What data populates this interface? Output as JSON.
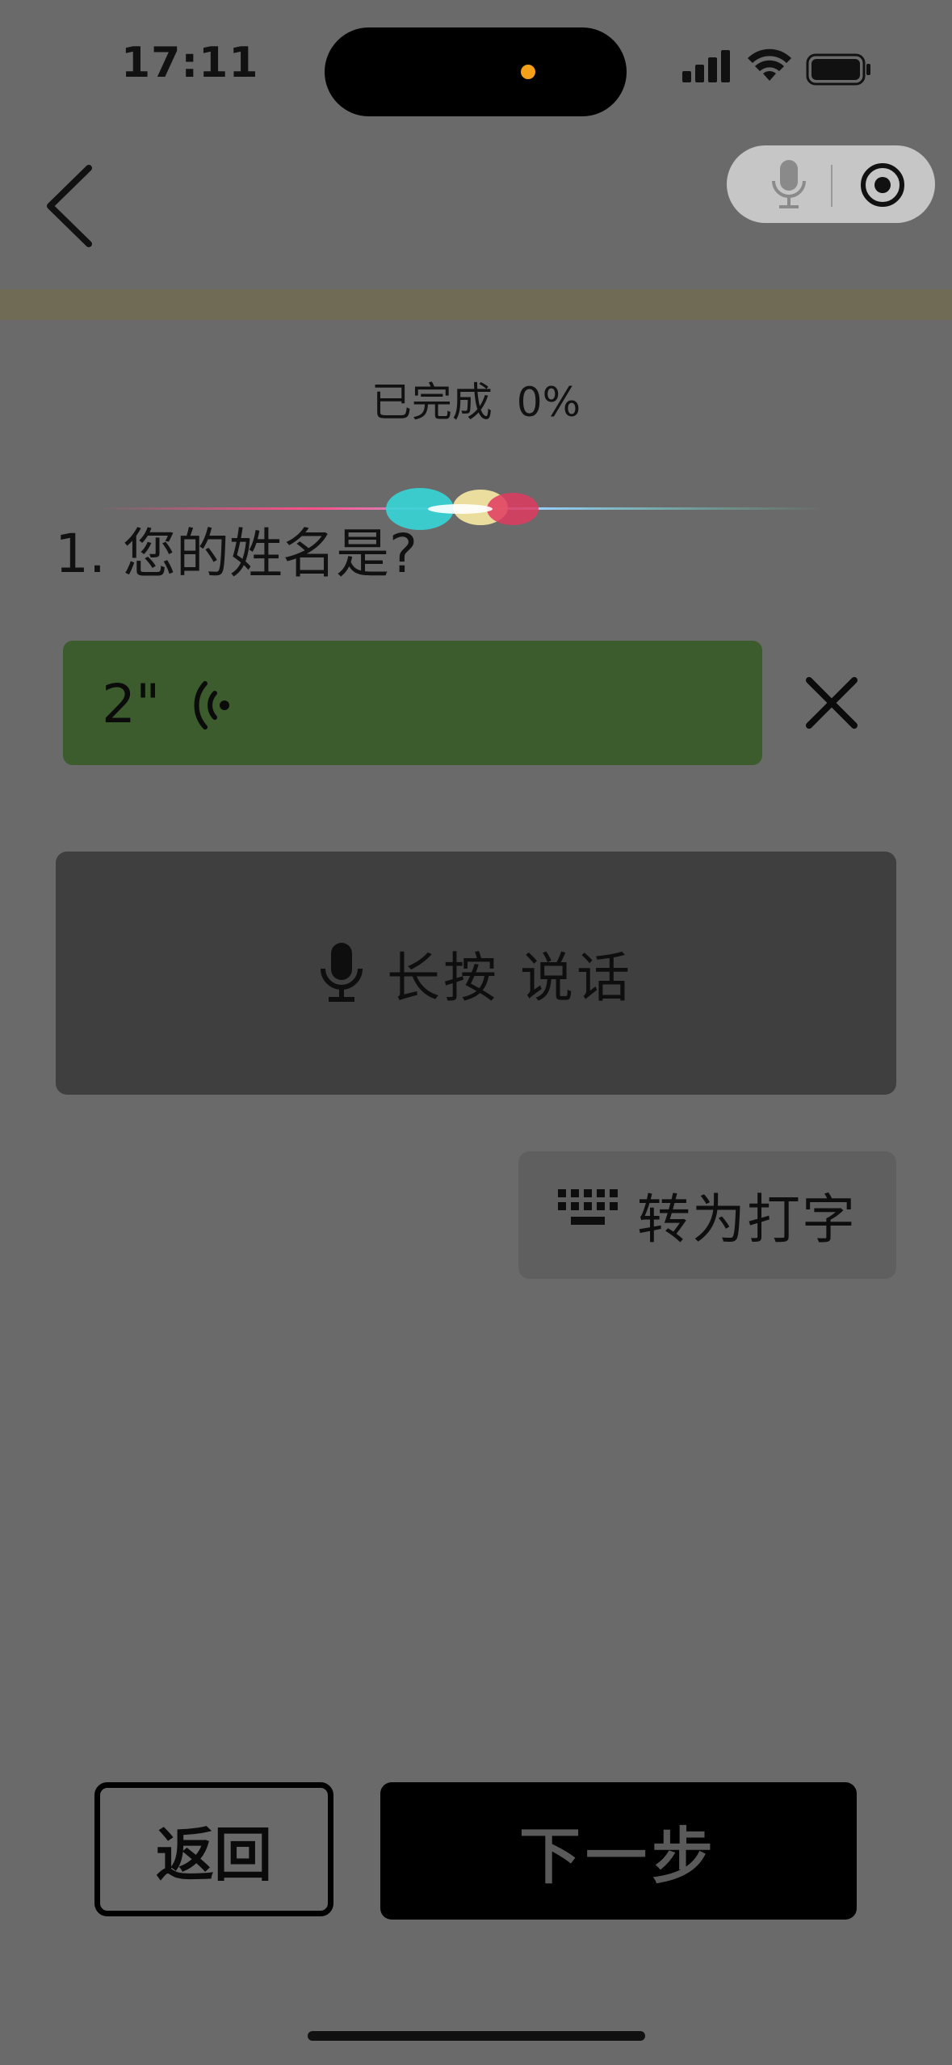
{
  "status_bar": {
    "time": "17:11"
  },
  "progress": {
    "label": "已完成",
    "value": "0%"
  },
  "question": {
    "text": "1. 您的姓名是?"
  },
  "voice_message": {
    "duration": "2\""
  },
  "hold_to_talk": {
    "label": "长按 说话"
  },
  "switch_typing": {
    "label": "转为打字"
  },
  "footer": {
    "back_label": "返回",
    "next_label": "下一步"
  },
  "colors": {
    "background": "#6a6a6a",
    "voice_bubble": "#3d5c2d",
    "hold_button": "#3f3f3f",
    "recording_dot": "#f4a019"
  },
  "icons": [
    "back-chevron-icon",
    "microphone-icon",
    "target-icon",
    "close-icon",
    "keyboard-icon",
    "sound-wave-icon",
    "signal-icon",
    "wifi-icon",
    "battery-icon"
  ]
}
